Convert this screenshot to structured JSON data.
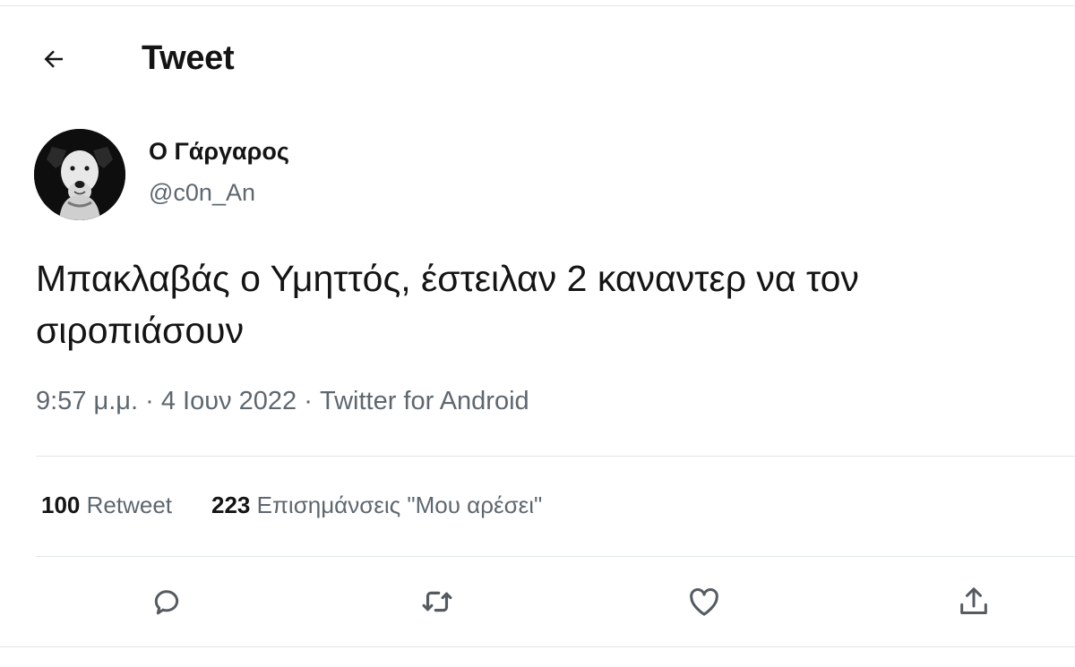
{
  "header": {
    "title": "Tweet",
    "back_icon": "arrow-left-icon"
  },
  "author": {
    "name": "Ο Γάργαρος",
    "handle": "@c0n_An",
    "avatar": "dog-avatar"
  },
  "tweet": {
    "text_line1": "Μπακλαβάς ο Υμηττός, έστειλαν 2 καναντερ να τον",
    "text_line2": "σιροπιάσουν",
    "time": "9:57 μ.μ.",
    "separator": "·",
    "date": "4 Ιουν 2022",
    "source": "Twitter for Android"
  },
  "stats": {
    "retweets_count": "100",
    "retweets_label": "Retweet",
    "likes_count": "223",
    "likes_label": "Επισημάνσεις \"Μου αρέσει\""
  },
  "actions": {
    "reply_icon": "reply-icon",
    "retweet_icon": "retweet-icon",
    "like_icon": "heart-icon",
    "share_icon": "share-icon"
  },
  "colors": {
    "text": "#141414",
    "secondary": "#5e6770",
    "divider": "#e3e6e9"
  }
}
